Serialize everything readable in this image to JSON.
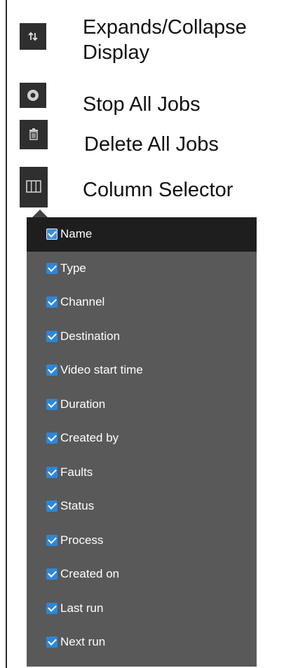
{
  "legend": {
    "expand": {
      "label": "Expands/Collapse\nDisplay",
      "icon": "expand-collapse-icon"
    },
    "stop": {
      "label": "Stop All Jobs",
      "icon": "stop-icon"
    },
    "delete": {
      "label": "Delete All Jobs",
      "icon": "trash-icon"
    },
    "column_selector": {
      "label": "Column Selector",
      "icon": "columns-icon"
    }
  },
  "column_menu": {
    "items": [
      {
        "label": "Name",
        "checked": true,
        "highlighted": true
      },
      {
        "label": "Type",
        "checked": true
      },
      {
        "label": "Channel",
        "checked": true
      },
      {
        "label": "Destination",
        "checked": true
      },
      {
        "label": "Video start time",
        "checked": true
      },
      {
        "label": "Duration",
        "checked": true
      },
      {
        "label": "Created by",
        "checked": true
      },
      {
        "label": "Faults",
        "checked": true
      },
      {
        "label": "Status",
        "checked": true
      },
      {
        "label": "Process",
        "checked": true
      },
      {
        "label": "Created on",
        "checked": true
      },
      {
        "label": "Last run",
        "checked": true
      },
      {
        "label": "Next run",
        "checked": true
      }
    ]
  },
  "colors": {
    "icon_bg": "#2f2f2f",
    "menu_bg": "#595959",
    "menu_highlight": "#1e1e1e",
    "checkbox": "#2f86d6"
  }
}
